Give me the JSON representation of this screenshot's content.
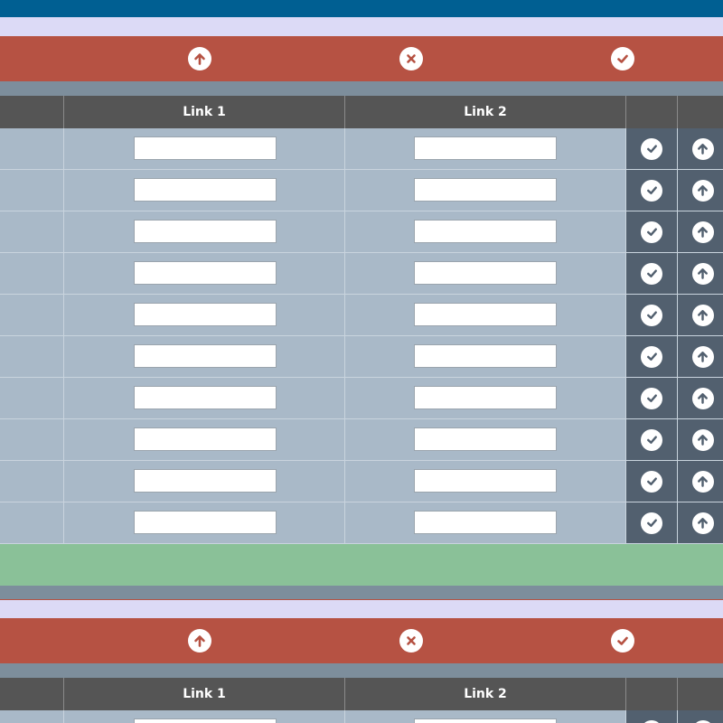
{
  "colors": {
    "top_bar": "#005f92",
    "band": "#dcdaf6",
    "toolbar": "#b65243",
    "gap": "#7d8e9c",
    "header": "#555555",
    "row": "#a9b9c8",
    "action_cell": "#52606f",
    "footer": "#8ac198"
  },
  "toolbar": {
    "buttons": [
      {
        "name": "upload",
        "icon": "arrow-up-circle-icon"
      },
      {
        "name": "cancel",
        "icon": "x-circle-icon"
      },
      {
        "name": "confirm",
        "icon": "check-circle-icon"
      }
    ]
  },
  "table": {
    "columns": [
      "",
      "Link 1",
      "Link 2",
      "",
      ""
    ],
    "rows": [
      {
        "link1": "",
        "link2": ""
      },
      {
        "link1": "",
        "link2": ""
      },
      {
        "link1": "",
        "link2": ""
      },
      {
        "link1": "",
        "link2": ""
      },
      {
        "link1": "",
        "link2": ""
      },
      {
        "link1": "",
        "link2": ""
      },
      {
        "link1": "",
        "link2": ""
      },
      {
        "link1": "",
        "link2": ""
      },
      {
        "link1": "",
        "link2": ""
      },
      {
        "link1": "",
        "link2": ""
      }
    ],
    "row_actions": [
      {
        "name": "confirm",
        "icon": "check-circle-icon"
      },
      {
        "name": "upload",
        "icon": "arrow-up-circle-icon"
      }
    ]
  }
}
